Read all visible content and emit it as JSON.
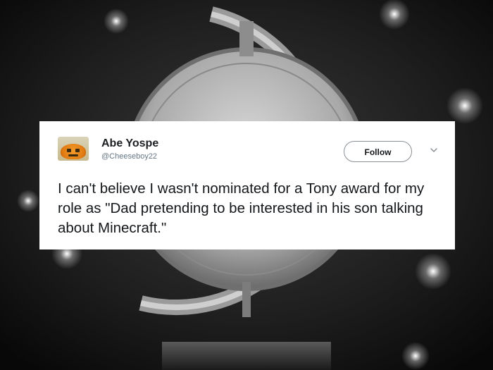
{
  "tweet": {
    "display_name": "Abe Yospe",
    "handle": "@Cheeseboy22",
    "follow_label": "Follow",
    "text": "I can't believe I wasn't nominated for a Tony award for my role as \"Dad pretending to be interested in his son talking about Minecraft.\""
  },
  "icons": {
    "menu": "chevron-down-icon",
    "avatar": "pumpkin-avatar"
  },
  "colors": {
    "background": "#141414",
    "card": "#ffffff",
    "text": "#14171a",
    "handle": "#657786"
  }
}
